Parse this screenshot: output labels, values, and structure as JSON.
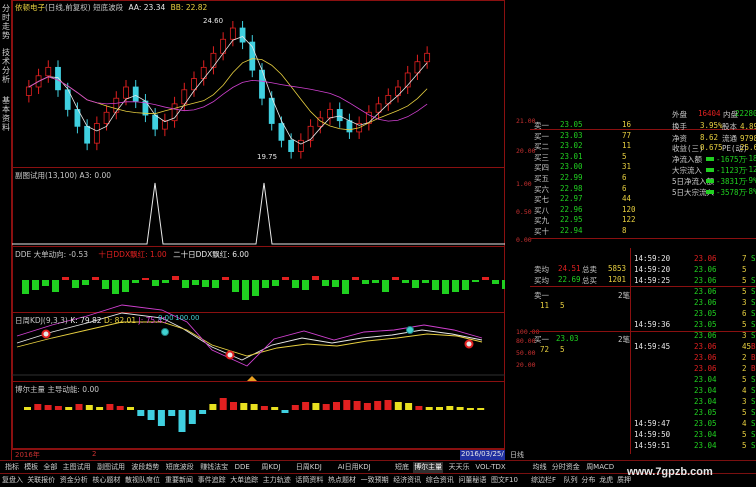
{
  "sidebar": {
    "tabs": [
      "分时走势",
      "技术分析",
      "基本资料"
    ]
  },
  "main_panel": {
    "name": "依顿电子",
    "title_rest": "(日线,前复权) 短底波段",
    "aa": "AA: 23.34",
    "bb": "BB: 22.82",
    "hi_label": "24.60",
    "lo_label": "19.75",
    "axis": [
      "21.00",
      "20.00"
    ]
  },
  "sub_panel": {
    "title": "副图试用(13,100)",
    "a3": "A3: 0.00",
    "axis": [
      "1.00",
      "0.50",
      "0.00"
    ]
  },
  "dde_panel": {
    "title": "DDE 大单动向:",
    "value": "-0.53",
    "ten": "十日DDX飘红: 1.00",
    "twenty": "二十日DDX飘红: 6.00"
  },
  "kdj_panel": {
    "title": "日周KDJ(9,3,3)",
    "k": "K: 79.82",
    "d": "D: 82.01",
    "j": "J: 75.45",
    "m1": "0.00",
    "m2": "100.00",
    "axis": [
      "100.00",
      "80.00",
      "50.00",
      "20.00"
    ]
  },
  "force_panel": {
    "title": "博尔主量",
    "sub": "主导动能: 0.00"
  },
  "timebar": {
    "left": "2016年",
    "mid": "2",
    "date": "2016/03/25/五",
    "period": "日线"
  },
  "right_panel": {
    "top": {
      "l1": "外盘",
      "v1": "16404",
      "l2": "内盘",
      "v2": "22280"
    },
    "asks": [
      {
        "label": "卖一",
        "price": "23.05",
        "vol": "16"
      },
      {
        "label": "买一",
        "price": "23.03",
        "vol": "77"
      },
      {
        "label": "买二",
        "price": "23.02",
        "vol": "11"
      },
      {
        "label": "买三",
        "price": "23.01",
        "vol": "5"
      },
      {
        "label": "买四",
        "price": "23.00",
        "vol": "31"
      },
      {
        "label": "买五",
        "price": "22.99",
        "vol": "6"
      },
      {
        "label": "买六",
        "price": "22.98",
        "vol": "6"
      },
      {
        "label": "买七",
        "price": "22.97",
        "vol": "44"
      },
      {
        "label": "买八",
        "price": "22.96",
        "vol": "120"
      },
      {
        "label": "买九",
        "price": "22.95",
        "vol": "122"
      },
      {
        "label": "买十",
        "price": "22.94",
        "vol": "8"
      }
    ],
    "stats": [
      {
        "l": "换手",
        "v": "3.95%",
        "l2": "股本",
        "v2": "4.89亿"
      },
      {
        "l": "净资",
        "v": "8.62",
        "l2": "流通",
        "v2": "9798万"
      },
      {
        "l": "收益(三)",
        "v": "0.675",
        "l2": "PE(动)",
        "v2": "25.6"
      }
    ],
    "flows": [
      {
        "l": "净流入额",
        "v": "-1675万",
        "p": "-18%"
      },
      {
        "l": "大宗流入",
        "v": "-1123万",
        "p": "-12%"
      },
      {
        "l": "5日净流入额",
        "v": "-3831万",
        "p": "-9%"
      },
      {
        "l": "5日大宗流入",
        "v": "-3578万",
        "p": "-8%"
      }
    ],
    "avg": [
      {
        "l": "卖均",
        "v": "24.51",
        "l2": "总卖",
        "v2": "5853"
      },
      {
        "l": "买均",
        "v": "22.69",
        "l2": "总买",
        "v2": "1201"
      }
    ],
    "mid1": {
      "l": "卖一",
      "v": "11",
      "v2": "5",
      "r": "2笔"
    },
    "mid2": {
      "l": "买一",
      "p": "23.03",
      "r": "2笔",
      "v": "72",
      "v2": "5"
    },
    "ticks": [
      {
        "t": "14:59:20",
        "p": "23.06",
        "v": "7",
        "s": "S"
      },
      {
        "t": "14:59:20",
        "p": "23.06",
        "v": "5",
        "s": ""
      },
      {
        "t": "14:59:25",
        "p": "23.06",
        "v": "5",
        "s": "S"
      },
      {
        "t": "",
        "p": "23.06",
        "v": "5",
        "s": "S"
      },
      {
        "t": "",
        "p": "23.06",
        "v": "3",
        "s": "S"
      },
      {
        "t": "",
        "p": "23.05",
        "v": "6",
        "s": "S"
      },
      {
        "t": "14:59:36",
        "p": "23.05",
        "v": "5",
        "s": "S"
      },
      {
        "t": "",
        "p": "23.06",
        "v": "3",
        "s": "S"
      },
      {
        "t": "14:59:45",
        "p": "23.06",
        "v": "45",
        "s": "B"
      },
      {
        "t": "",
        "p": "23.06",
        "v": "2",
        "s": "B"
      },
      {
        "t": "",
        "p": "23.06",
        "v": "2",
        "s": "B"
      },
      {
        "t": "",
        "p": "23.04",
        "v": "5",
        "s": "S"
      },
      {
        "t": "",
        "p": "23.04",
        "v": "4",
        "s": "S"
      },
      {
        "t": "",
        "p": "23.04",
        "v": "3",
        "s": "S"
      },
      {
        "t": "",
        "p": "23.05",
        "v": "5",
        "s": "S"
      },
      {
        "t": "14:59:47",
        "p": "23.05",
        "v": "4",
        "s": "S"
      },
      {
        "t": "14:59:50",
        "p": "23.04",
        "v": "5",
        "s": "S"
      },
      {
        "t": "14:59:51",
        "p": "23.04",
        "v": "5",
        "s": "S"
      }
    ]
  },
  "tabs_row1": [
    "指标",
    "模板",
    "全部",
    "主图试用",
    "副图试用",
    "波段趋势",
    "短底波段",
    "赚钱法宝",
    "DDE",
    "周KDJ",
    "日周KDJ",
    "AI日用KDJ",
    "短底",
    "博尔主量",
    "天天乐",
    "VOL-TDX",
    "均线",
    "分时资金",
    "周MACD"
  ],
  "tabs_row2": [
    "复盘入",
    "关联报价",
    "资金分析",
    "核心题材",
    "散视队席位",
    "重要新闻",
    "事件追踪",
    "大单追踪",
    "主力轨迹",
    "话筒资料",
    "热点题材",
    "一致预期",
    "经济资讯",
    "综合资讯",
    "问董秘语",
    "图文F10",
    "综边栏F",
    "队列",
    "分布",
    "龙虎",
    "质押"
  ],
  "watermark": "www.7gpzb.com"
}
